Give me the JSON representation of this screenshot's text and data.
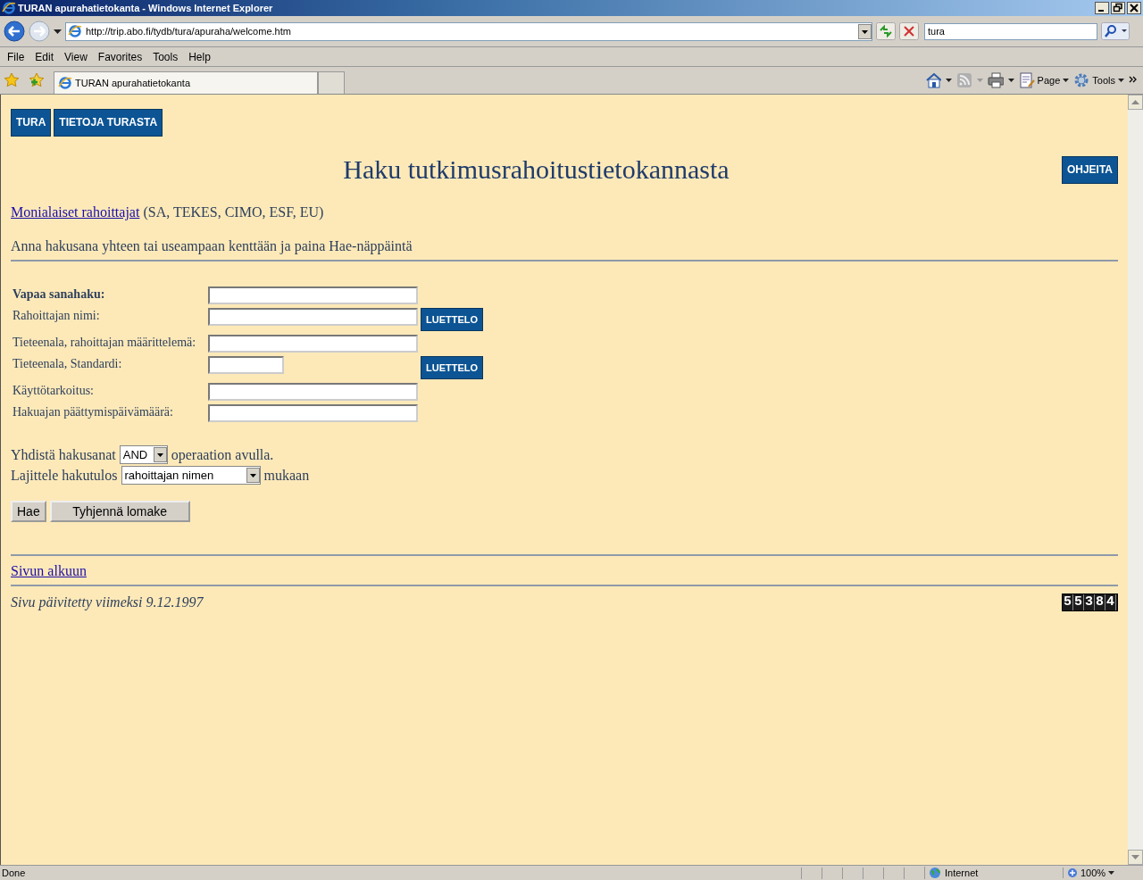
{
  "window": {
    "title": "TURAN apurahatietokanta - Windows Internet Explorer"
  },
  "address_bar": {
    "url": "http://trip.abo.fi/tydb/tura/apuraha/welcome.htm",
    "search_value": "tura"
  },
  "menu": [
    "File",
    "Edit",
    "View",
    "Favorites",
    "Tools",
    "Help"
  ],
  "tabs": [
    {
      "label": "TURAN apurahatietokanta",
      "selected": true
    }
  ],
  "command_bar": [
    {
      "kind": "home"
    },
    {
      "kind": "feeds"
    },
    {
      "kind": "print"
    },
    {
      "kind": "page",
      "label": "Page"
    },
    {
      "kind": "tools",
      "label": "Tools"
    }
  ],
  "page": {
    "nav_buttons": [
      "TURA",
      "TIETOJA TURASTA"
    ],
    "heading": "Haku tutkimusrahoitustietokannasta",
    "help_button": "OHJEITA",
    "funders_link": "Monialaiset rahoittajat",
    "funders_note": "(SA, TEKES, CIMO, ESF, EU)",
    "instruction": "Anna hakusana yhteen tai useampaan kenttään ja paina Hae-näppäintä",
    "fields": [
      {
        "label": "Vapaa sanahaku:",
        "kind": "wide",
        "bold": true
      },
      {
        "label": "Rahoittajan nimi:",
        "kind": "wide",
        "bold": false,
        "button": "LUETTELO"
      },
      {
        "label": "Tieteenala, rahoittajan määrittelemä:",
        "kind": "wide",
        "bold": false
      },
      {
        "label": "Tieteenala, Standardi:",
        "kind": "narrow",
        "bold": false,
        "button": "LUETTELO"
      },
      {
        "label": "Käyttötarkoitus:",
        "kind": "wide",
        "bold": false
      },
      {
        "label": "Hakuajan päättymispäivämäärä:",
        "kind": "wide",
        "bold": false
      }
    ],
    "combine": {
      "before": "Yhdistä hakusanat",
      "value": "AND",
      "after": "operaation avulla."
    },
    "sort": {
      "before": "Lajittele hakutulos",
      "value": "rahoittajan nimen",
      "after": "mukaan"
    },
    "buttons": [
      "Hae",
      "Tyhjennä lomake"
    ],
    "top_link": "Sivun alkuun",
    "updated": "Sivu päivitetty viimeksi 9.12.1997",
    "counter": "55384"
  },
  "status_bar": {
    "text": "Done",
    "zone": "Internet",
    "zoom": "100%"
  }
}
